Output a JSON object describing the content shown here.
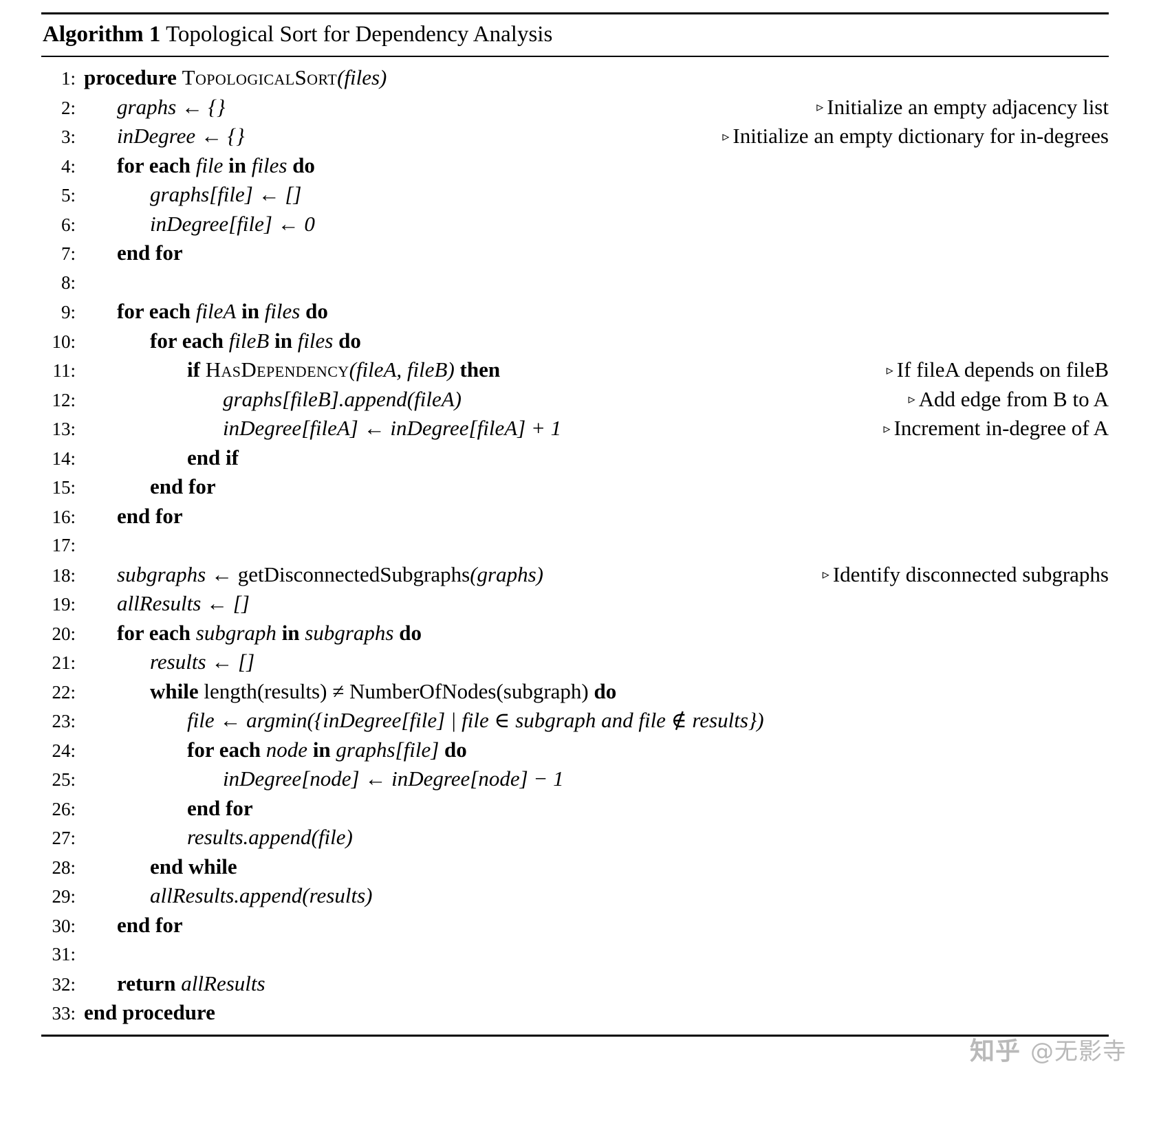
{
  "algorithm": {
    "caption_label": "Algorithm 1",
    "caption_title": "Topological Sort for Dependency Analysis",
    "comment_marker": "▹",
    "lines": [
      {
        "no": "1:",
        "indent": 0,
        "comment": ""
      },
      {
        "no": "2:",
        "indent": 1,
        "comment": "Initialize an empty adjacency list"
      },
      {
        "no": "3:",
        "indent": 1,
        "comment": "Initialize an empty dictionary for in-degrees"
      },
      {
        "no": "4:",
        "indent": 1,
        "comment": ""
      },
      {
        "no": "5:",
        "indent": 2,
        "comment": ""
      },
      {
        "no": "6:",
        "indent": 2,
        "comment": ""
      },
      {
        "no": "7:",
        "indent": 1,
        "comment": ""
      },
      {
        "no": "8:",
        "indent": 1,
        "comment": ""
      },
      {
        "no": "9:",
        "indent": 1,
        "comment": ""
      },
      {
        "no": "10:",
        "indent": 2,
        "comment": ""
      },
      {
        "no": "11:",
        "indent": 3,
        "comment": "If fileA depends on fileB"
      },
      {
        "no": "12:",
        "indent": 4,
        "comment": "Add edge from B to A"
      },
      {
        "no": "13:",
        "indent": 4,
        "comment": "Increment in-degree of A"
      },
      {
        "no": "14:",
        "indent": 3,
        "comment": ""
      },
      {
        "no": "15:",
        "indent": 2,
        "comment": ""
      },
      {
        "no": "16:",
        "indent": 1,
        "comment": ""
      },
      {
        "no": "17:",
        "indent": 1,
        "comment": ""
      },
      {
        "no": "18:",
        "indent": 1,
        "comment": "Identify disconnected subgraphs"
      },
      {
        "no": "19:",
        "indent": 1,
        "comment": ""
      },
      {
        "no": "20:",
        "indent": 1,
        "comment": ""
      },
      {
        "no": "21:",
        "indent": 2,
        "comment": ""
      },
      {
        "no": "22:",
        "indent": 2,
        "comment": ""
      },
      {
        "no": "23:",
        "indent": 3,
        "comment": ""
      },
      {
        "no": "24:",
        "indent": 3,
        "comment": ""
      },
      {
        "no": "25:",
        "indent": 4,
        "comment": ""
      },
      {
        "no": "26:",
        "indent": 3,
        "comment": ""
      },
      {
        "no": "27:",
        "indent": 3,
        "comment": ""
      },
      {
        "no": "28:",
        "indent": 2,
        "comment": ""
      },
      {
        "no": "29:",
        "indent": 2,
        "comment": ""
      },
      {
        "no": "30:",
        "indent": 1,
        "comment": ""
      },
      {
        "no": "31:",
        "indent": 1,
        "comment": ""
      },
      {
        "no": "32:",
        "indent": 1,
        "comment": ""
      },
      {
        "no": "33:",
        "indent": 0,
        "comment": ""
      }
    ],
    "code_text": {
      "l1_kw": "procedure",
      "l1_name": "TopologicalSort",
      "l1_args": "(files)",
      "l2": "graphs ← {}",
      "l3": "inDegree ← {}",
      "l4_kw": "for each",
      "l4_v1": "file",
      "l4_in": "in",
      "l4_v2": "files",
      "l4_do": "do",
      "l5": "graphs[file] ← []",
      "l6": "inDegree[file] ← 0",
      "l7": "end for",
      "l8": "",
      "l9_kw": "for each",
      "l9_v1": "fileA",
      "l9_in": "in",
      "l9_v2": "files",
      "l9_do": "do",
      "l10_kw": "for each",
      "l10_v1": "fileB",
      "l10_in": "in",
      "l10_v2": "files",
      "l10_do": "do",
      "l11_if": "if",
      "l11_name": "HasDependency",
      "l11_args": "(fileA, fileB)",
      "l11_then": "then",
      "l12": "graphs[fileB].append(fileA)",
      "l13": "inDegree[fileA] ← inDegree[fileA] + 1",
      "l14": "end if",
      "l15": "end for",
      "l16": "end for",
      "l17": "",
      "l18_lhs": "subgraphs ← ",
      "l18_call": "getDisconnectedSubgraphs",
      "l18_args": "(graphs)",
      "l19": "allResults ← []",
      "l20_kw": "for each",
      "l20_v1": "subgraph",
      "l20_in": "in",
      "l20_v2": "subgraphs",
      "l20_do": "do",
      "l21": "results ← []",
      "l22_kw": "while",
      "l22_expr": "length(results) ≠ NumberOfNodes(subgraph)",
      "l22_do": "do",
      "l23": "file ← argmin({inDegree[file] | file ∈ subgraph and file ∉ results})",
      "l24_kw": "for each",
      "l24_v1": "node",
      "l24_in": "in",
      "l24_v2": "graphs[file]",
      "l24_do": "do",
      "l25": "inDegree[node] ← inDegree[node] − 1",
      "l26": "end for",
      "l27": "results.append(file)",
      "l28": "end while",
      "l29": "allResults.append(results)",
      "l30": "end for",
      "l31": "",
      "l32_kw": "return",
      "l32_var": "allResults",
      "l33": "end procedure"
    }
  },
  "watermark": {
    "logo": "知乎",
    "user": "@无影寺"
  }
}
